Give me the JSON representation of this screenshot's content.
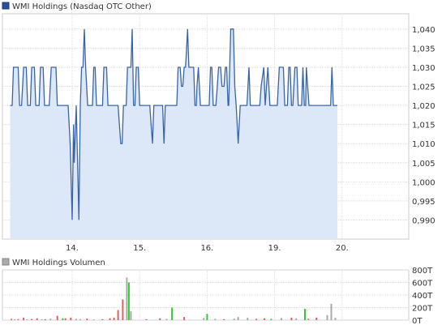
{
  "chart_data": [
    {
      "type": "area",
      "legend": "WMI Holdings (Nasdaq OTC Other)",
      "xlabels": [
        "14.",
        "15.",
        "16.",
        "19.",
        "20."
      ],
      "ylabels": [
        "1,040",
        "1,035",
        "1,030",
        "1,025",
        "1,020",
        "1,015",
        "1,010",
        "1,005",
        "1,000",
        "0,995",
        "0,990"
      ],
      "ylim": [
        0.985,
        1.044
      ],
      "yticks": [
        1.04,
        1.035,
        1.03,
        1.025,
        1.02,
        1.015,
        1.01,
        1.005,
        1.0,
        0.995,
        0.99
      ],
      "grid": true,
      "colors": {
        "line": "#3a64a8",
        "fill": "#dce8f8",
        "grid": "#dddddd",
        "legend_box": "#2b4f9a"
      },
      "series": [
        {
          "name": "WMI Holdings (Nasdaq OTC Other)",
          "points": [
            [
              -0.92,
              1.02
            ],
            [
              -0.89,
              1.02
            ],
            [
              -0.87,
              1.03
            ],
            [
              -0.8,
              1.03
            ],
            [
              -0.78,
              1.02
            ],
            [
              -0.75,
              1.02
            ],
            [
              -0.72,
              1.03
            ],
            [
              -0.68,
              1.03
            ],
            [
              -0.66,
              1.02
            ],
            [
              -0.62,
              1.02
            ],
            [
              -0.6,
              1.03
            ],
            [
              -0.56,
              1.03
            ],
            [
              -0.54,
              1.02
            ],
            [
              -0.49,
              1.02
            ],
            [
              -0.47,
              1.03
            ],
            [
              -0.43,
              1.03
            ],
            [
              -0.41,
              1.02
            ],
            [
              -0.34,
              1.02
            ],
            [
              -0.31,
              1.03
            ],
            [
              -0.24,
              1.03
            ],
            [
              -0.22,
              1.02
            ],
            [
              -0.06,
              1.02
            ],
            [
              -0.03,
              1.01
            ],
            [
              0.0,
              0.99
            ],
            [
              0.02,
              1.015
            ],
            [
              0.03,
              1.005
            ],
            [
              0.06,
              1.02
            ],
            [
              0.1,
              0.99
            ],
            [
              0.12,
              1.02
            ],
            [
              0.14,
              1.03
            ],
            [
              0.16,
              1.03
            ],
            [
              0.18,
              1.04
            ],
            [
              0.2,
              1.03
            ],
            [
              0.23,
              1.02
            ],
            [
              0.3,
              1.02
            ],
            [
              0.32,
              1.03
            ],
            [
              0.34,
              1.03
            ],
            [
              0.36,
              1.02
            ],
            [
              0.45,
              1.02
            ],
            [
              0.47,
              1.03
            ],
            [
              0.51,
              1.03
            ],
            [
              0.53,
              1.02
            ],
            [
              0.68,
              1.02
            ],
            [
              0.7,
              1.015
            ],
            [
              0.72,
              1.01
            ],
            [
              0.74,
              1.01
            ],
            [
              0.76,
              1.02
            ],
            [
              0.8,
              1.02
            ],
            [
              0.82,
              1.03
            ],
            [
              0.87,
              1.03
            ],
            [
              0.89,
              1.04
            ],
            [
              0.91,
              1.02
            ],
            [
              0.93,
              1.02
            ],
            [
              0.95,
              1.03
            ],
            [
              0.98,
              1.03
            ],
            [
              1.0,
              1.02
            ],
            [
              1.15,
              1.02
            ],
            [
              1.17,
              1.015
            ],
            [
              1.19,
              1.01
            ],
            [
              1.21,
              1.02
            ],
            [
              1.34,
              1.02
            ],
            [
              1.36,
              1.01
            ],
            [
              1.38,
              1.02
            ],
            [
              1.43,
              1.02
            ],
            [
              1.45,
              1.02
            ],
            [
              1.55,
              1.02
            ],
            [
              1.57,
              1.03
            ],
            [
              1.6,
              1.03
            ],
            [
              1.62,
              1.025
            ],
            [
              1.64,
              1.025
            ],
            [
              1.66,
              1.03
            ],
            [
              1.68,
              1.03
            ],
            [
              1.71,
              1.04
            ],
            [
              1.73,
              1.03
            ],
            [
              1.8,
              1.03
            ],
            [
              1.82,
              1.02
            ],
            [
              1.84,
              1.02
            ],
            [
              1.85,
              1.025
            ],
            [
              1.87,
              1.03
            ],
            [
              1.9,
              1.02
            ],
            [
              2.03,
              1.02
            ],
            [
              2.05,
              1.03
            ],
            [
              2.07,
              1.03
            ],
            [
              2.09,
              1.02
            ],
            [
              2.13,
              1.02
            ],
            [
              2.15,
              1.025
            ],
            [
              2.17,
              1.03
            ],
            [
              2.2,
              1.03
            ],
            [
              2.22,
              1.025
            ],
            [
              2.25,
              1.025
            ],
            [
              2.27,
              1.03
            ],
            [
              2.29,
              1.03
            ],
            [
              2.31,
              1.02
            ],
            [
              2.32,
              1.02
            ],
            [
              2.35,
              1.04
            ],
            [
              2.39,
              1.04
            ],
            [
              2.41,
              1.025
            ],
            [
              2.43,
              1.02
            ],
            [
              2.46,
              1.01
            ],
            [
              2.49,
              1.02
            ],
            [
              2.59,
              1.02
            ],
            [
              2.62,
              1.03
            ],
            [
              2.64,
              1.02
            ],
            [
              2.78,
              1.02
            ],
            [
              2.8,
              1.025
            ],
            [
              2.84,
              1.03
            ],
            [
              2.86,
              1.02
            ],
            [
              2.88,
              1.025
            ],
            [
              2.9,
              1.03
            ],
            [
              2.93,
              1.02
            ],
            [
              3.04,
              1.02
            ],
            [
              3.07,
              1.03
            ],
            [
              3.13,
              1.03
            ],
            [
              3.15,
              1.02
            ],
            [
              3.19,
              1.02
            ],
            [
              3.21,
              1.03
            ],
            [
              3.23,
              1.03
            ],
            [
              3.25,
              1.02
            ],
            [
              3.27,
              1.02
            ],
            [
              3.3,
              1.03
            ],
            [
              3.33,
              1.03
            ],
            [
              3.35,
              1.02
            ],
            [
              3.4,
              1.02
            ],
            [
              3.42,
              1.03
            ],
            [
              3.44,
              1.02
            ],
            [
              3.46,
              1.02
            ],
            [
              3.47,
              1.03
            ],
            [
              3.51,
              1.02
            ],
            [
              3.83,
              1.02
            ],
            [
              3.85,
              1.03
            ],
            [
              3.87,
              1.02
            ],
            [
              3.93,
              1.02
            ]
          ]
        }
      ]
    },
    {
      "type": "bar",
      "legend": "WMI Holdings Volumen",
      "ylabels": [
        "800T",
        "600T",
        "400T",
        "200T",
        "0T"
      ],
      "ylim": [
        0,
        800
      ],
      "yticks": [
        800,
        600,
        400,
        200,
        0
      ],
      "grid": true,
      "colors": {
        "up": "#33cc33",
        "down": "#e06060",
        "neutral": "#aaaaaa",
        "grid": "#dddddd",
        "legend_box": "#aaaaaa"
      },
      "series": [
        {
          "name": "WMI Holdings Volumen",
          "bars": [
            [
              -0.9,
              "down",
              20
            ],
            [
              -0.85,
              "neutral",
              15
            ],
            [
              -0.8,
              "down",
              15
            ],
            [
              -0.72,
              "down",
              40
            ],
            [
              -0.67,
              "neutral",
              12
            ],
            [
              -0.6,
              "down",
              18
            ],
            [
              -0.52,
              "down",
              30
            ],
            [
              -0.45,
              "neutral",
              12
            ],
            [
              -0.4,
              "down",
              15
            ],
            [
              -0.32,
              "neutral",
              25
            ],
            [
              -0.22,
              "down",
              70
            ],
            [
              -0.14,
              "up",
              30
            ],
            [
              -0.1,
              "down",
              30
            ],
            [
              -0.02,
              "down",
              40
            ],
            [
              0.06,
              "neutral",
              20
            ],
            [
              0.12,
              "neutral",
              15
            ],
            [
              0.22,
              "down",
              25
            ],
            [
              0.32,
              "neutral",
              12
            ],
            [
              0.45,
              "down",
              15
            ],
            [
              0.56,
              "down",
              30
            ],
            [
              0.62,
              "down",
              40
            ],
            [
              0.68,
              "down",
              160
            ],
            [
              0.75,
              "down",
              330
            ],
            [
              0.81,
              "neutral",
              680
            ],
            [
              0.84,
              "up",
              600
            ],
            [
              0.87,
              "neutral",
              140
            ],
            [
              1.1,
              "down",
              15
            ],
            [
              1.3,
              "down",
              30
            ],
            [
              1.4,
              "neutral",
              20
            ],
            [
              1.48,
              "up",
              200
            ],
            [
              1.66,
              "down",
              50
            ],
            [
              1.95,
              "neutral",
              35
            ],
            [
              2.0,
              "up",
              100
            ],
            [
              2.12,
              "neutral",
              20
            ],
            [
              2.25,
              "down",
              15
            ],
            [
              2.4,
              "neutral",
              25
            ],
            [
              2.46,
              "neutral",
              50
            ],
            [
              2.6,
              "neutral",
              40
            ],
            [
              2.73,
              "down",
              20
            ],
            [
              2.85,
              "down",
              30
            ],
            [
              2.95,
              "up",
              20
            ],
            [
              3.1,
              "neutral",
              35
            ],
            [
              3.25,
              "down",
              40
            ],
            [
              3.32,
              "neutral",
              30
            ],
            [
              3.45,
              "up",
              180
            ],
            [
              3.5,
              "down",
              20
            ],
            [
              3.62,
              "down",
              40
            ],
            [
              3.78,
              "neutral",
              80
            ],
            [
              3.84,
              "neutral",
              260
            ],
            [
              3.9,
              "neutral",
              40
            ]
          ]
        }
      ]
    }
  ]
}
